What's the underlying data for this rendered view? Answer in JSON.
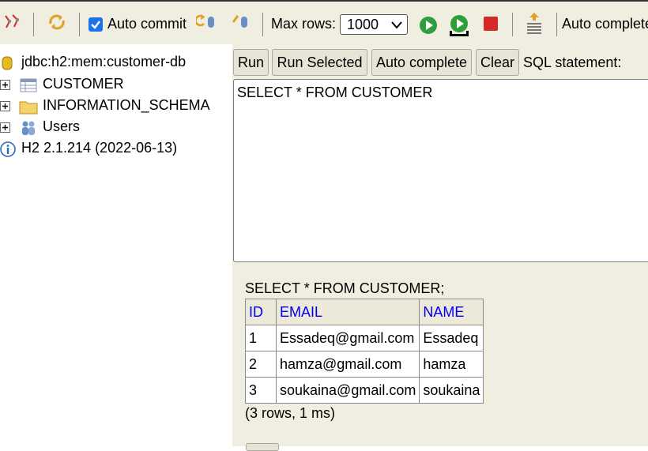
{
  "toolbar": {
    "auto_commit_label": "Auto commit",
    "auto_commit_checked": true,
    "max_rows_label": "Max rows:",
    "max_rows_value": "1000",
    "auto_complete_label": "Auto complete"
  },
  "tree": {
    "connection": "jdbc:h2:mem:customer-db",
    "items": [
      {
        "label": "CUSTOMER",
        "icon": "table-icon"
      },
      {
        "label": "INFORMATION_SCHEMA",
        "icon": "folder-icon"
      },
      {
        "label": "Users",
        "icon": "users-icon"
      }
    ],
    "version": "H2 2.1.214 (2022-06-13)"
  },
  "query_panel": {
    "run_label": "Run",
    "run_selected_label": "Run Selected",
    "auto_complete_label": "Auto complete",
    "clear_label": "Clear",
    "sql_label": "SQL statement:",
    "sql_text": "SELECT * FROM CUSTOMER"
  },
  "results": {
    "statement": "SELECT * FROM CUSTOMER;",
    "columns": [
      "ID",
      "EMAIL",
      "NAME"
    ],
    "rows": [
      [
        "1",
        "Essadeq@gmail.com",
        "Essadeq"
      ],
      [
        "2",
        "hamza@gmail.com",
        "hamza"
      ],
      [
        "3",
        "soukaina@gmail.com",
        "soukaina"
      ]
    ],
    "info": "(3 rows, 1 ms)"
  },
  "colors": {
    "panel_bg": "#f0eee0",
    "header_link": "#0000ee",
    "run_green": "#2e9e3a",
    "stop_red": "#d62828"
  }
}
